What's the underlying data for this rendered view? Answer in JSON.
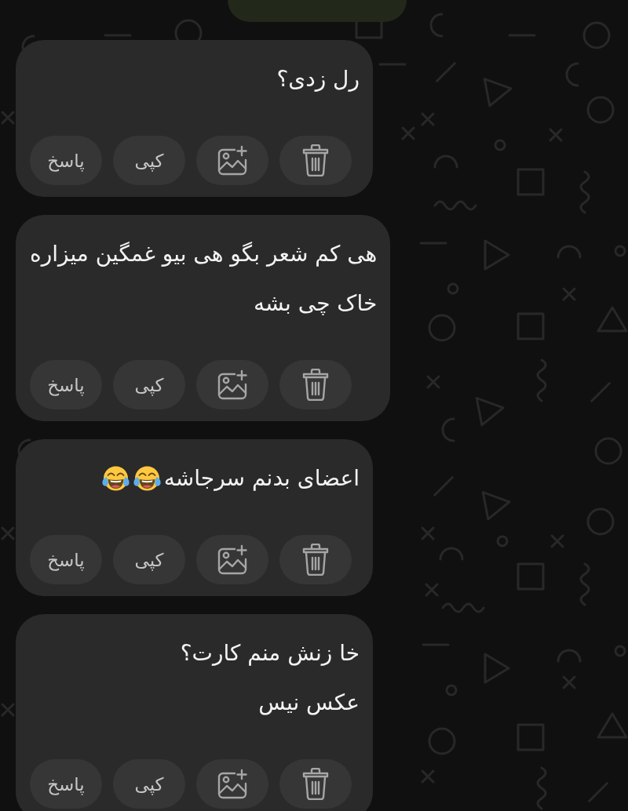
{
  "messages": [
    {
      "outgoing": true
    },
    {
      "outgoing": false,
      "lines": [
        {
          "text": "رل زدی؟"
        }
      ],
      "actions": [
        {
          "kind": "delete"
        },
        {
          "kind": "add-image"
        },
        {
          "kind": "label",
          "label": "کپی"
        },
        {
          "kind": "label",
          "label": "پاسخ"
        }
      ]
    },
    {
      "outgoing": false,
      "lines": [
        {
          "text": "هی کم شعر بگو هی بیو غمگین میزاره"
        },
        {
          "text": "خاک چی بشه"
        }
      ],
      "actions": [
        {
          "kind": "delete"
        },
        {
          "kind": "add-image"
        },
        {
          "kind": "label",
          "label": "کپی"
        },
        {
          "kind": "label",
          "label": "پاسخ"
        }
      ]
    },
    {
      "outgoing": false,
      "lines": [
        {
          "text": "اعضای بدنم سرجاشه",
          "emojis": [
            {
              "kind": "tears-of-joy"
            },
            {
              "kind": "tears-of-joy"
            }
          ]
        }
      ],
      "actions": [
        {
          "kind": "delete"
        },
        {
          "kind": "add-image"
        },
        {
          "kind": "label",
          "label": "کپی"
        },
        {
          "kind": "label",
          "label": "پاسخ"
        }
      ]
    },
    {
      "outgoing": false,
      "lines": [
        {
          "text": "خا زنش منم کارت؟"
        },
        {
          "text": "عکس نیس"
        }
      ],
      "actions": [
        {
          "kind": "delete"
        },
        {
          "kind": "add-image"
        },
        {
          "kind": "label",
          "label": "کپی"
        },
        {
          "kind": "label",
          "label": "پاسخ"
        }
      ]
    }
  ]
}
